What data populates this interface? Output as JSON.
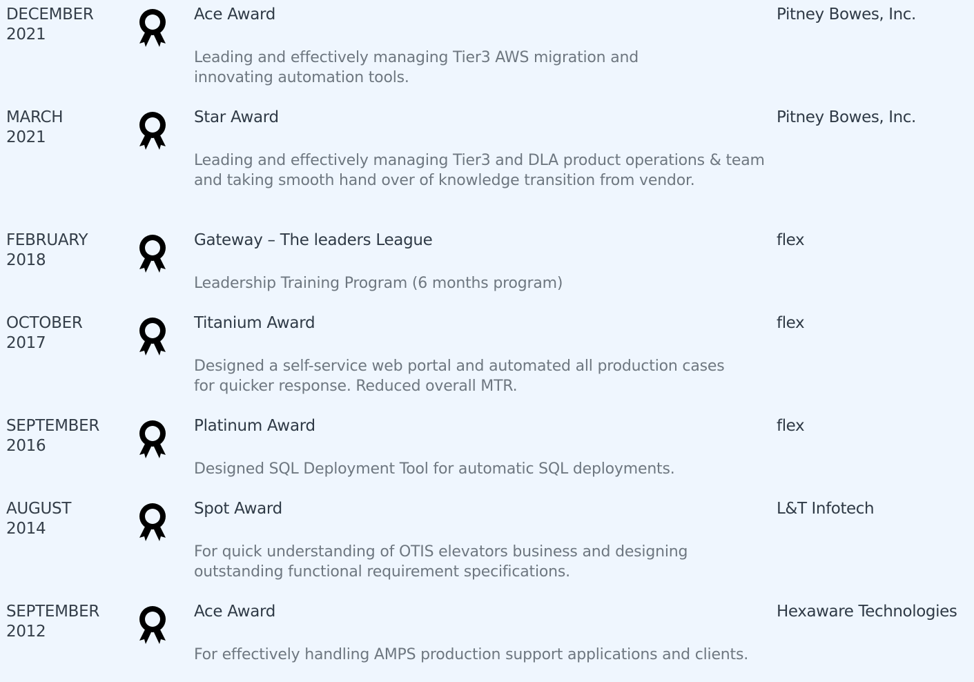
{
  "awards": [
    {
      "month": "DECEMBER",
      "year": "2021",
      "title": "Ace Award",
      "description": "Leading and effectively managing Tier3 AWS migration and innovating automation tools.",
      "company": "Pitney Bowes, Inc.",
      "icon": "award-ribbon-icon"
    },
    {
      "month": "MARCH",
      "year": "2021",
      "title": "Star Award",
      "description": "Leading and effectively managing Tier3 and DLA product operations & team and taking smooth hand over of knowledge transition from vendor.",
      "company": "Pitney Bowes, Inc.",
      "icon": "award-ribbon-icon"
    },
    {
      "month": "FEBRUARY",
      "year": "2018",
      "title": "Gateway – The leaders League",
      "description": "Leadership Training Program (6 months program)",
      "company": "flex",
      "icon": "award-ribbon-icon"
    },
    {
      "month": "OCTOBER",
      "year": "2017",
      "title": "Titanium Award",
      "description": "Designed a self-service web portal and automated all production cases for quicker response. Reduced overall MTR.",
      "company": "flex",
      "icon": "award-ribbon-icon"
    },
    {
      "month": "SEPTEMBER",
      "year": "2016",
      "title": "Platinum Award",
      "description": "Designed SQL Deployment Tool for automatic SQL deployments.",
      "company": "flex",
      "icon": "award-ribbon-icon"
    },
    {
      "month": "AUGUST",
      "year": "2014",
      "title": "Spot Award",
      "description": "For quick understanding of OTIS elevators business and designing outstanding functional requirement specifications.",
      "company": "L&T Infotech",
      "icon": "award-ribbon-icon"
    },
    {
      "month": "SEPTEMBER",
      "year": "2012",
      "title": "Ace Award",
      "description": "For effectively handling AMPS production support applications and clients.",
      "company": "Hexaware Technologies",
      "icon": "award-ribbon-icon"
    }
  ]
}
